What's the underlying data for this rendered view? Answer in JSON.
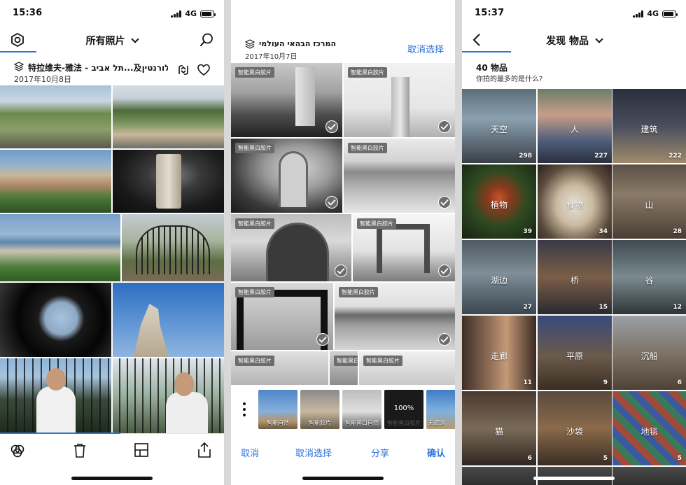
{
  "left": {
    "time": "15:36",
    "network": "4G",
    "title": "所有照片",
    "album": {
      "title": "特拉维夫-雅法 - תל אביב...及פלורנטין",
      "date": "2017年10月8日"
    }
  },
  "middle": {
    "title": "המרכז הבהאי העולמי",
    "date": "2017年10月7日",
    "deselect_top": "取消选择",
    "tag": "智能黑白胶片",
    "filters": [
      {
        "label": "智能自然",
        "percent": ""
      },
      {
        "label": "智能胶片",
        "percent": ""
      },
      {
        "label": "智能黑白自然",
        "percent": ""
      },
      {
        "label": "智能黑白胶片",
        "percent": "100%"
      },
      {
        "label": "无滤镜",
        "percent": ""
      }
    ],
    "actions": {
      "cancel": "取消",
      "deselect": "取消选择",
      "share": "分享",
      "confirm": "确认"
    }
  },
  "right": {
    "time": "15:37",
    "network": "4G",
    "title": "发现 物品",
    "count_title": "40 物品",
    "subtitle": "你拍的最多的是什么?",
    "categories": [
      {
        "label": "天空",
        "count": "298"
      },
      {
        "label": "人",
        "count": "227"
      },
      {
        "label": "建筑",
        "count": "222"
      },
      {
        "label": "植物",
        "count": "39"
      },
      {
        "label": "食物",
        "count": "34"
      },
      {
        "label": "山",
        "count": "28"
      },
      {
        "label": "湖边",
        "count": "27"
      },
      {
        "label": "桥",
        "count": "15"
      },
      {
        "label": "谷",
        "count": "12"
      },
      {
        "label": "走廊",
        "count": "11"
      },
      {
        "label": "平原",
        "count": "9"
      },
      {
        "label": "沉船",
        "count": "6"
      },
      {
        "label": "猫",
        "count": "6"
      },
      {
        "label": "沙袋",
        "count": "5"
      },
      {
        "label": "地毯",
        "count": "5"
      }
    ]
  },
  "colors": {
    "accent": "#2f73d8"
  }
}
